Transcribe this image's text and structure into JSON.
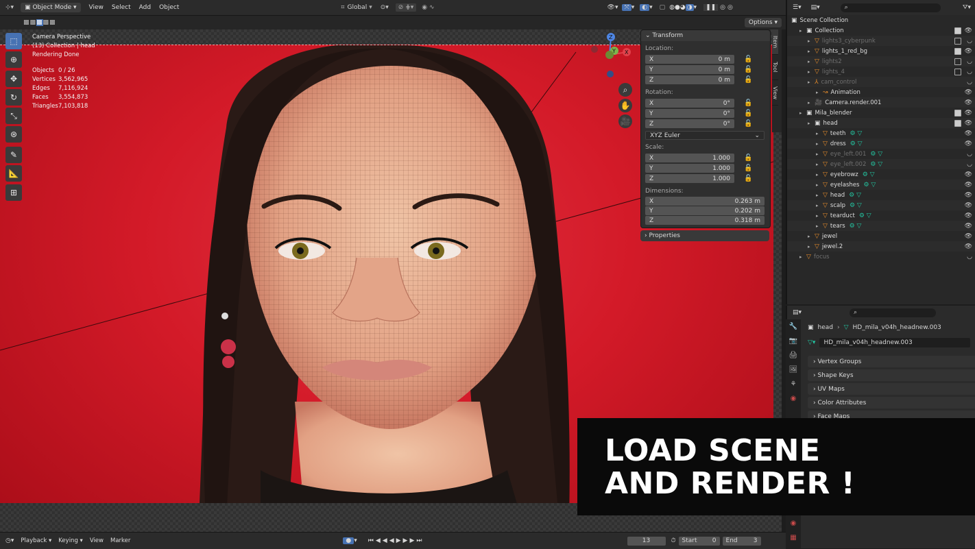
{
  "header": {
    "mode": "Object Mode",
    "menus": [
      "View",
      "Select",
      "Add",
      "Object"
    ],
    "transform_orientation": "Global",
    "options_label": "Options"
  },
  "viewport": {
    "overlay_lines": [
      "Camera Perspective",
      "(13) Collection | head",
      "Rendering Done"
    ],
    "stats": [
      {
        "label": "Objects",
        "value": "0 / 26"
      },
      {
        "label": "Vertices",
        "value": "3,562,965"
      },
      {
        "label": "Edges",
        "value": "7,116,924"
      },
      {
        "label": "Faces",
        "value": "3,554,873"
      },
      {
        "label": "Triangles",
        "value": "7,103,818"
      }
    ],
    "gizmo_axis": {
      "z": "Z",
      "x": "X",
      "y": "Y"
    }
  },
  "npanel": {
    "title": "Transform",
    "location_label": "Location:",
    "location": [
      {
        "axis": "X",
        "value": "0 m"
      },
      {
        "axis": "Y",
        "value": "0 m"
      },
      {
        "axis": "Z",
        "value": "0 m"
      }
    ],
    "rotation_label": "Rotation:",
    "rotation": [
      {
        "axis": "X",
        "value": "0°"
      },
      {
        "axis": "Y",
        "value": "0°"
      },
      {
        "axis": "Z",
        "value": "0°"
      }
    ],
    "rotation_mode": "XYZ Euler",
    "scale_label": "Scale:",
    "scale": [
      {
        "axis": "X",
        "value": "1.000"
      },
      {
        "axis": "Y",
        "value": "1.000"
      },
      {
        "axis": "Z",
        "value": "1.000"
      }
    ],
    "dimensions_label": "Dimensions:",
    "dimensions": [
      {
        "axis": "X",
        "value": "0.263 m"
      },
      {
        "axis": "Y",
        "value": "0.202 m"
      },
      {
        "axis": "Z",
        "value": "0.318 m"
      }
    ],
    "properties_label": "Properties",
    "tabs": [
      "Item",
      "Tool",
      "View"
    ]
  },
  "outliner": {
    "root": "Scene Collection",
    "rows": [
      {
        "name": "Collection",
        "indent": 1,
        "dim": false
      },
      {
        "name": "lights3_cyberpunk",
        "indent": 2,
        "dim": true
      },
      {
        "name": "lights_1_red_bg",
        "indent": 2,
        "dim": false
      },
      {
        "name": "lights2",
        "indent": 2,
        "dim": true
      },
      {
        "name": "lights_4",
        "indent": 2,
        "dim": true
      },
      {
        "name": "cam_control",
        "indent": 2,
        "dim": true
      },
      {
        "name": "Animation",
        "indent": 3,
        "dim": false
      },
      {
        "name": "Camera.render.001",
        "indent": 2,
        "dim": false
      },
      {
        "name": "Mila_blender",
        "indent": 1,
        "dim": false
      },
      {
        "name": "head",
        "indent": 2,
        "dim": false
      },
      {
        "name": "teeth",
        "indent": 3,
        "dim": false
      },
      {
        "name": "dress",
        "indent": 3,
        "dim": false
      },
      {
        "name": "eye_left.001",
        "indent": 3,
        "dim": true
      },
      {
        "name": "eye_left.002",
        "indent": 3,
        "dim": true
      },
      {
        "name": "eyebrowz",
        "indent": 3,
        "dim": false
      },
      {
        "name": "eyelashes",
        "indent": 3,
        "dim": false
      },
      {
        "name": "head",
        "indent": 3,
        "dim": false
      },
      {
        "name": "scalp",
        "indent": 3,
        "dim": false
      },
      {
        "name": "tearduct",
        "indent": 3,
        "dim": false
      },
      {
        "name": "tears",
        "indent": 3,
        "dim": false
      },
      {
        "name": "jewel",
        "indent": 2,
        "dim": false
      },
      {
        "name": "jewel.2",
        "indent": 2,
        "dim": false
      },
      {
        "name": "focus",
        "indent": 1,
        "dim": true
      }
    ]
  },
  "properties": {
    "breadcrumb_object": "head",
    "breadcrumb_mesh": "HD_mila_v04h_headnew.003",
    "mesh_name": "HD_mila_v04h_headnew.003",
    "sections": [
      "Vertex Groups",
      "Shape Keys",
      "UV Maps",
      "Color Attributes",
      "Face Maps"
    ]
  },
  "timeline": {
    "menus": [
      "Playback",
      "Keying",
      "View",
      "Marker"
    ],
    "current_frame": "13",
    "start_label": "Start",
    "start": "0",
    "end_label": "End",
    "end": "3"
  },
  "banner": {
    "line1": "LOAD SCENE",
    "line2": "AND RENDER !"
  }
}
